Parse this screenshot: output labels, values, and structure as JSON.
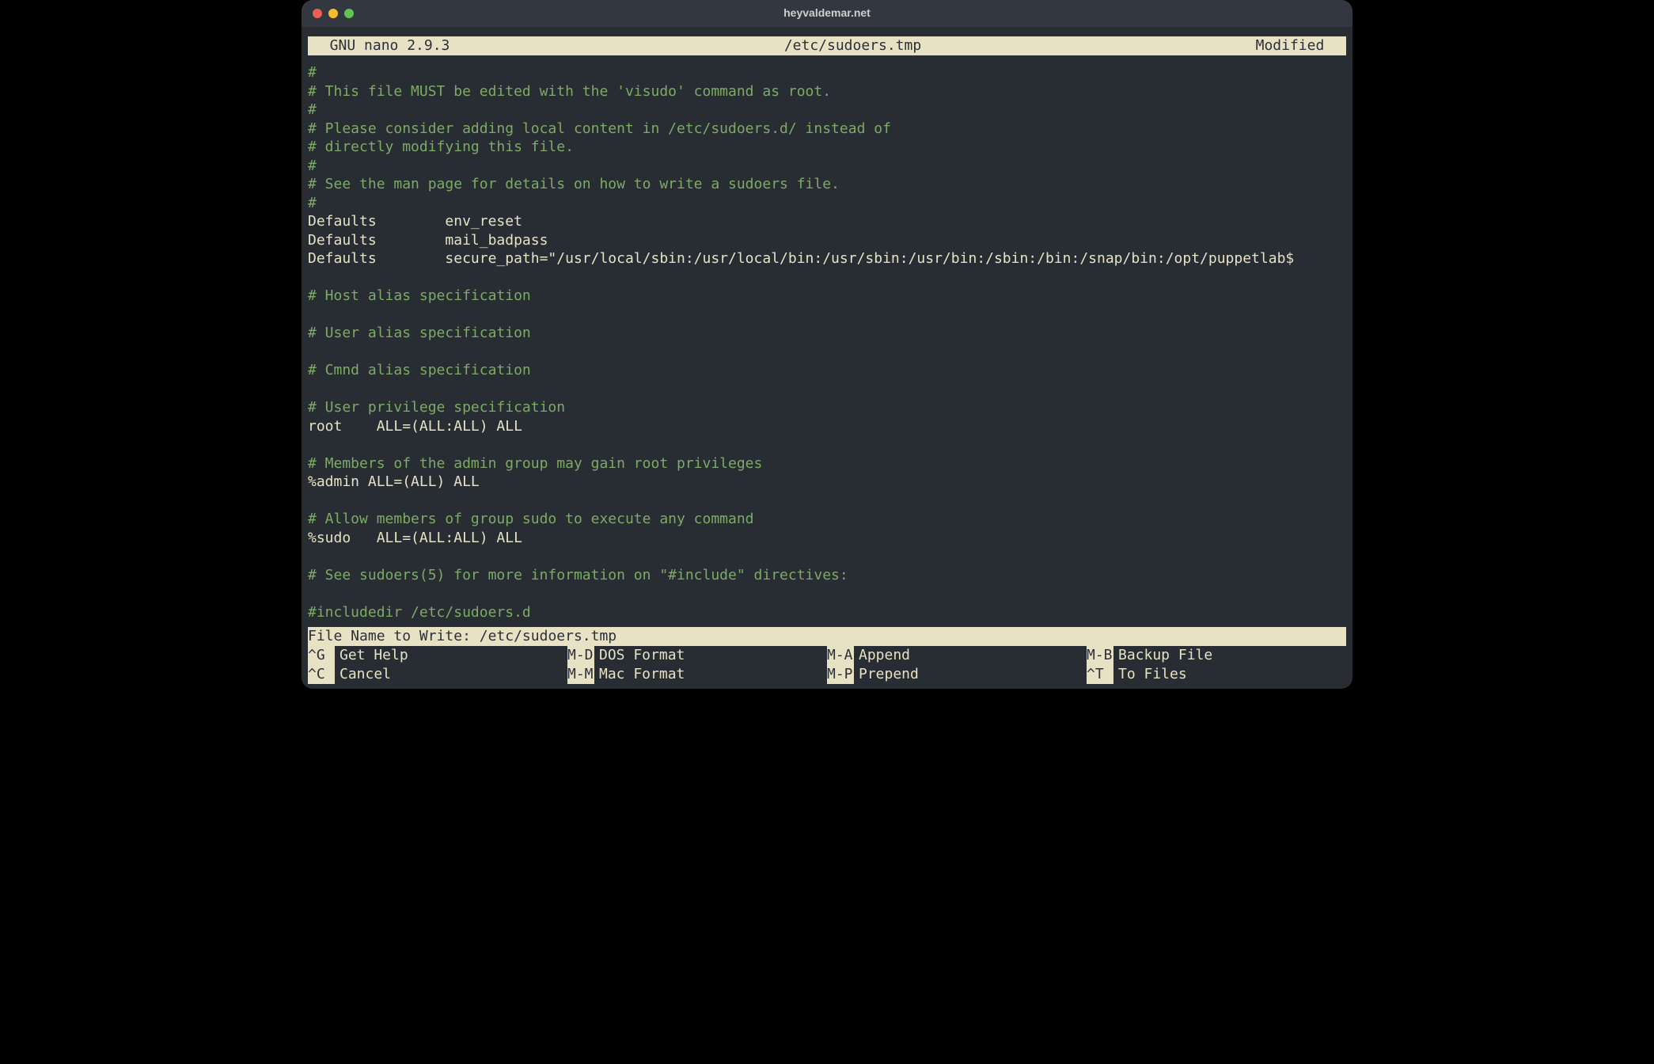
{
  "titlebar": {
    "title": "heyvaldemar.net"
  },
  "nano_header": {
    "left": "  GNU nano 2.9.3",
    "center": "/etc/sudoers.tmp",
    "right": "Modified  "
  },
  "lines": [
    {
      "cls": "comment",
      "text": "#"
    },
    {
      "cls": "comment",
      "text": "# This file MUST be edited with the 'visudo' command as root."
    },
    {
      "cls": "comment",
      "text": "#"
    },
    {
      "cls": "comment",
      "text": "# Please consider adding local content in /etc/sudoers.d/ instead of"
    },
    {
      "cls": "comment",
      "text": "# directly modifying this file."
    },
    {
      "cls": "comment",
      "text": "#"
    },
    {
      "cls": "comment",
      "text": "# See the man page for details on how to write a sudoers file."
    },
    {
      "cls": "comment",
      "text": "#"
    },
    {
      "cls": "plain",
      "text": "Defaults        env_reset"
    },
    {
      "cls": "plain",
      "text": "Defaults        mail_badpass"
    },
    {
      "cls": "plain",
      "text": "Defaults        secure_path=\"/usr/local/sbin:/usr/local/bin:/usr/sbin:/usr/bin:/sbin:/bin:/snap/bin:/opt/puppetlab$"
    },
    {
      "cls": "plain",
      "text": ""
    },
    {
      "cls": "comment",
      "text": "# Host alias specification"
    },
    {
      "cls": "plain",
      "text": ""
    },
    {
      "cls": "comment",
      "text": "# User alias specification"
    },
    {
      "cls": "plain",
      "text": ""
    },
    {
      "cls": "comment",
      "text": "# Cmnd alias specification"
    },
    {
      "cls": "plain",
      "text": ""
    },
    {
      "cls": "comment",
      "text": "# User privilege specification"
    },
    {
      "cls": "plain",
      "text": "root    ALL=(ALL:ALL) ALL"
    },
    {
      "cls": "plain",
      "text": ""
    },
    {
      "cls": "comment",
      "text": "# Members of the admin group may gain root privileges"
    },
    {
      "cls": "plain",
      "text": "%admin ALL=(ALL) ALL"
    },
    {
      "cls": "plain",
      "text": ""
    },
    {
      "cls": "comment",
      "text": "# Allow members of group sudo to execute any command"
    },
    {
      "cls": "plain",
      "text": "%sudo   ALL=(ALL:ALL) ALL"
    },
    {
      "cls": "plain",
      "text": ""
    },
    {
      "cls": "comment",
      "text": "# See sudoers(5) for more information on \"#include\" directives:"
    },
    {
      "cls": "plain",
      "text": ""
    },
    {
      "cls": "comment",
      "text": "#includedir /etc/sudoers.d"
    }
  ],
  "prompt": {
    "label": "File Name to Write: ",
    "value": "/etc/sudoers.tmp"
  },
  "shortcuts_row1": [
    {
      "key": "^G",
      "label": "Get Help"
    },
    {
      "key": "M-D",
      "label": "DOS Format"
    },
    {
      "key": "M-A",
      "label": "Append"
    },
    {
      "key": "M-B",
      "label": "Backup File"
    }
  ],
  "shortcuts_row2": [
    {
      "key": "^C",
      "label": "Cancel"
    },
    {
      "key": "M-M",
      "label": "Mac Format"
    },
    {
      "key": "M-P",
      "label": "Prepend"
    },
    {
      "key": "^T",
      "label": "To Files"
    }
  ]
}
